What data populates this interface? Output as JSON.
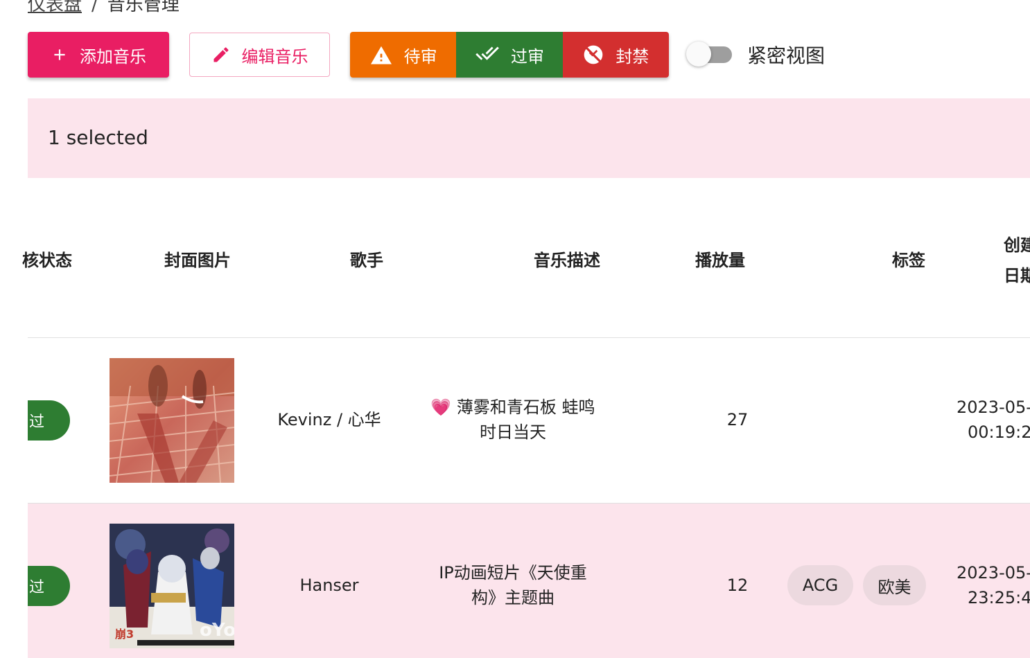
{
  "breadcrumb": {
    "home": "仪表盘",
    "separator": "/",
    "current": "音乐管理"
  },
  "toolbar": {
    "add_label": "添加音乐",
    "edit_label": "编辑音乐",
    "pending_label": "待审",
    "approve_label": "过审",
    "ban_label": "封禁",
    "compact_label": "紧密视图"
  },
  "colors": {
    "primary": "#e91e63",
    "pending": "#ef6c00",
    "approve": "#2e7d32",
    "ban": "#d32f2f",
    "selected_bg": "#fce4ec"
  },
  "selection": {
    "text": "1 selected"
  },
  "table": {
    "headers": {
      "status": "核状态",
      "cover": "封面图片",
      "artist": "歌手",
      "description": "音乐描述",
      "plays": "播放量",
      "tags": "标签",
      "created_line1": "创建",
      "created_line2": "日期"
    },
    "rows": [
      {
        "status": "过",
        "cover_icon": "album-cover-street",
        "artist": "Kevinz / 心华",
        "desc_line1": "💗 薄雾和青石板 蛙鸣",
        "desc_line2": "时日当天",
        "plays": "27",
        "tags": [],
        "created_line1": "2023-05-",
        "created_line2": "00:19:2"
      },
      {
        "status": "过",
        "cover_icon": "album-cover-anime",
        "artist": "Hanser",
        "desc_line1": "IP动画短片《天使重",
        "desc_line2": "构》主题曲",
        "plays": "12",
        "tags": [
          "ACG",
          "欧美"
        ],
        "created_line1": "2023-05-",
        "created_line2": "23:25:4"
      }
    ]
  }
}
